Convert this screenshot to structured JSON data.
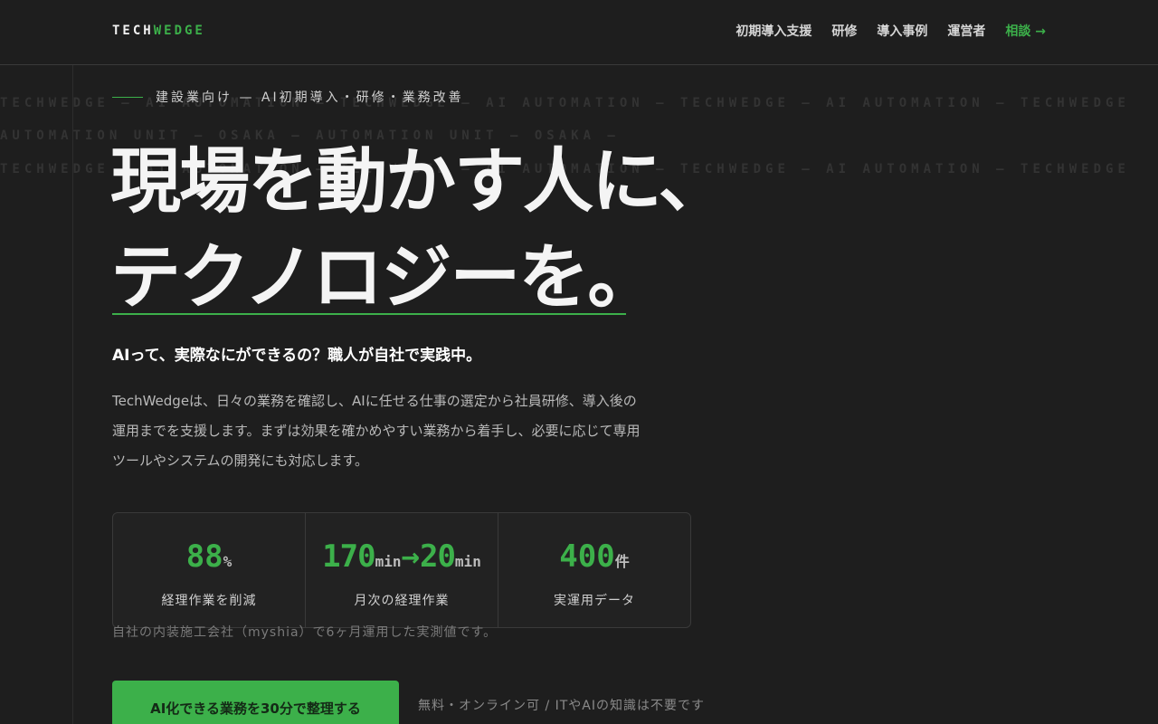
{
  "header": {
    "logo_a": "TECH",
    "logo_b": "WEDGE",
    "nav": [
      "初期導入支援",
      "研修",
      "導入事例",
      "運営者"
    ],
    "cta": "相談 →"
  },
  "ticker": {
    "row1": "TECHWEDGE — AI AUTOMATION — TECHWEDGE — AI AUTOMATION — TECHWEDGE — AI AUTOMATION — TECHWEDGE",
    "row2": "AUTOMATION UNIT — OSAKA — AUTOMATION UNIT — OSAKA —",
    "row3": "TECHWEDGE — AI AUTOMATION — TECHWEDGE — AI AUTOMATION — TECHWEDGE — AI AUTOMATION — TECHWEDGE"
  },
  "hero": {
    "eyebrow": "建設業向け — AI初期導入・研修・業務改善",
    "title_line1": "現場を動かす人に、",
    "title_line2": "テクノロジーを。",
    "lead": "AIって、実際なにができるの？職人が自社で実践中。",
    "body": "TechWedgeは、日々の業務を確認し、AIに任せる仕事の選定から社員研修、導入後の運用までを支援します。まずは効果を確かめやすい業務から着手し、必要に応じて専用ツールやシステムの開発にも対応します。"
  },
  "stats": [
    {
      "value": "88",
      "unit": "%",
      "label": "経理作業を削減"
    },
    {
      "value_a": "170",
      "unit_a": "min",
      "arrow": "→",
      "value_b": "20",
      "unit_b": "min",
      "label": "月次の経理作業"
    },
    {
      "value": "400",
      "unit": "件",
      "label": "実運用データ"
    }
  ],
  "note": "自社の内装施工会社（myshia）で6ヶ月運用した実測値です。",
  "cta_button": "AI化できる業務を30分で整理する",
  "cta_note": "無料・オンライン可 / ITやAIの知識は不要です",
  "colors": {
    "accent": "#3cb04a",
    "background": "#1e1e1e"
  }
}
